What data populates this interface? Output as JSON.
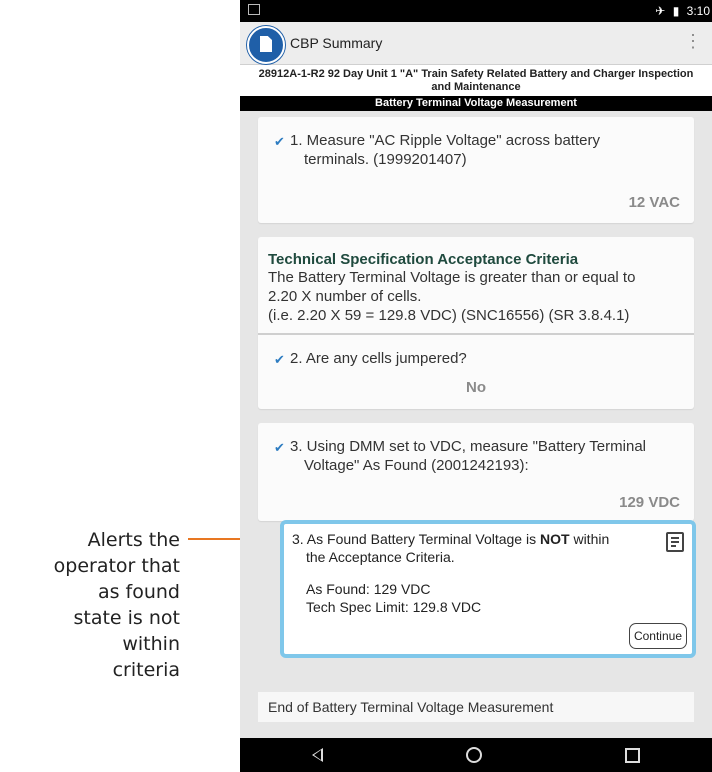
{
  "annotation": {
    "lines": [
      "Alerts the",
      "operator that",
      "as found",
      "state is not",
      "within",
      "criteria"
    ],
    "arrow_color": "#e87722"
  },
  "status_bar": {
    "time": "3:10",
    "icons": [
      "airplane-icon",
      "battery-icon"
    ]
  },
  "app": {
    "title": "CBP Summary",
    "accent": "#1f5fa8"
  },
  "document": {
    "title_line1": "28912A-1-R2 92 Day Unit 1 \"A\" Train Safety Related Battery and Charger Inspection",
    "title_line2": "and Maintenance",
    "section": "Battery Terminal Voltage Measurement"
  },
  "steps": [
    {
      "text_line1": "1. Measure \"AC Ripple Voltage\" across battery",
      "text_line2": "terminals. (1999201407)",
      "value": "12 VAC"
    }
  ],
  "criteria": {
    "title": "Technical Specification Acceptance Criteria",
    "line1": "The Battery Terminal Voltage is greater than or equal to",
    "line2": "2.20 X number of cells.",
    "line3": "(i.e. 2.20 X 59 = 129.8 VDC) (SNC16556) (SR 3.8.4.1)",
    "step_text": "2. Are any cells jumpered?",
    "step_value": "No"
  },
  "step3": {
    "text_line1": "3. Using DMM set to VDC, measure \"Battery Terminal",
    "text_line2": "Voltage\" As Found (2001242193):",
    "value": "129 VDC"
  },
  "alert": {
    "line1_prefix": "3. As Found Battery Terminal Voltage is ",
    "line1_bold": "NOT",
    "line1_suffix": " within",
    "line2": "the Acceptance Criteria.",
    "as_found": "As Found: 129 VDC",
    "limit": "Tech Spec Limit: 129.8 VDC",
    "button": "Continue",
    "border_color": "#7fc7ea"
  },
  "end_text": "End of Battery Terminal Voltage Measurement"
}
